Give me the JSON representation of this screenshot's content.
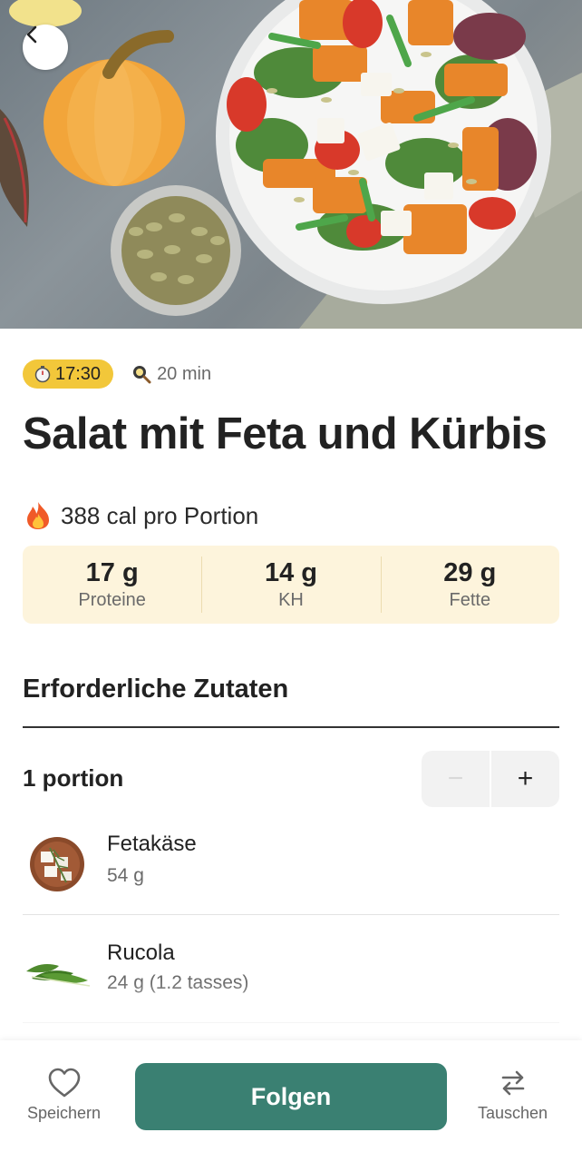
{
  "header": {
    "back_icon": "chevron-left-icon"
  },
  "recipe": {
    "time_badge": "17:30",
    "time_icon": "stopwatch-icon",
    "duration": "20 min",
    "duration_icon": "cooking-pan-icon",
    "title": "Salat mit Feta und Kürbis",
    "calories": "388 cal pro Portion",
    "calories_icon": "fire-icon"
  },
  "macros": [
    {
      "value": "17 g",
      "label": "Proteine"
    },
    {
      "value": "14 g",
      "label": "KH"
    },
    {
      "value": "29 g",
      "label": "Fette"
    }
  ],
  "ingredients_section": {
    "title": "Erforderliche Zutaten",
    "portion_label": "1 portion",
    "minus_label": "−",
    "plus_label": "+",
    "items": [
      {
        "name": "Fetakäse",
        "quantity": "54 g"
      },
      {
        "name": "Rucola",
        "quantity": "24 g (1.2 tasses)"
      }
    ]
  },
  "bottom_bar": {
    "save_label": "Speichern",
    "follow_label": "Folgen",
    "swap_label": "Tauschen"
  },
  "colors": {
    "accent": "#3a8072",
    "badge": "#f2c73a",
    "macro_bg": "#fdf4dc"
  }
}
